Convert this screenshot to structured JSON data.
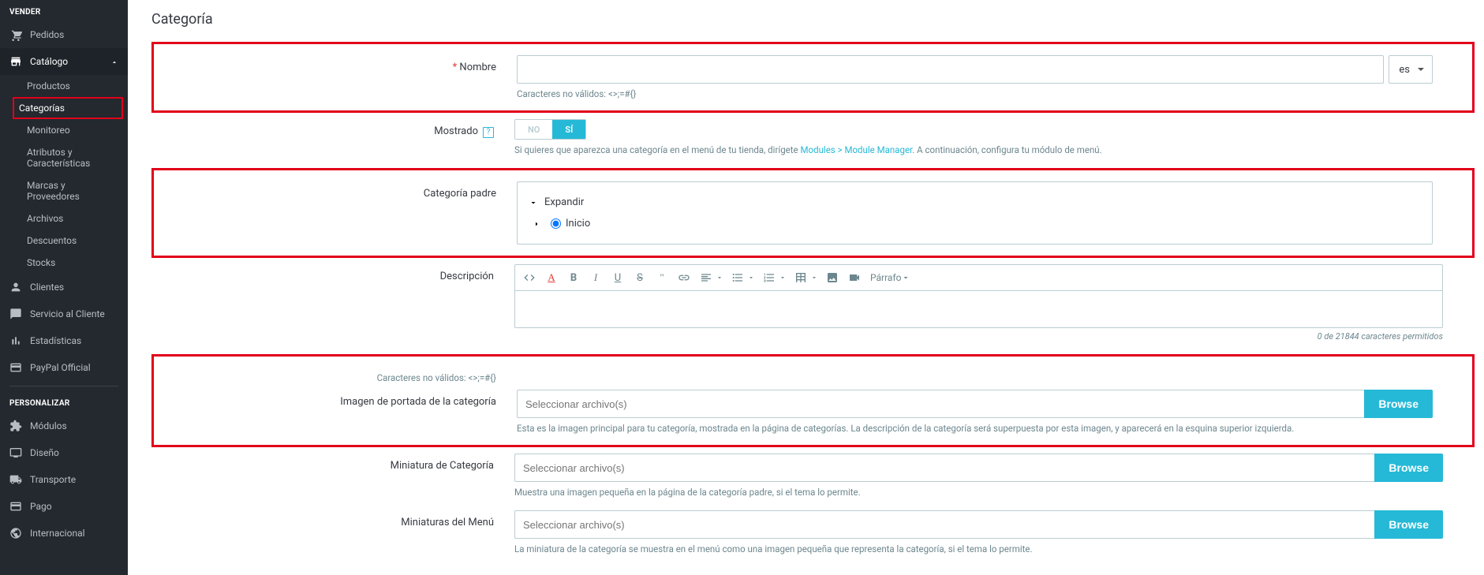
{
  "sidebar": {
    "sections": {
      "sell": {
        "title": "VENDER"
      },
      "customize": {
        "title": "PERSONALIZAR"
      }
    },
    "items": {
      "orders": "Pedidos",
      "catalog": "Catálogo",
      "customers": "Clientes",
      "service": "Servicio al Cliente",
      "stats": "Estadísticas",
      "paypal": "PayPal Official",
      "modules": "Módulos",
      "design": "Diseño",
      "shipping": "Transporte",
      "payment": "Pago",
      "intl": "Internacional"
    },
    "catalog_sub": {
      "products": "Productos",
      "categories": "Categorías",
      "monitoring": "Monitoreo",
      "attributes": "Atributos y Características",
      "brands": "Marcas y Proveedores",
      "files": "Archivos",
      "discounts": "Descuentos",
      "stocks": "Stocks"
    }
  },
  "page": {
    "title": "Categoría"
  },
  "form": {
    "name": {
      "label": "Nombre",
      "value": "",
      "lang": "es",
      "help": "Caracteres no válidos: <>;=#{}"
    },
    "displayed": {
      "label": "Mostrado",
      "no": "NO",
      "yes": "SÍ",
      "help_pre": "Si quieres que aparezca una categoría en el menú de tu tienda, dirígete ",
      "help_link": "Modules > Module Manager",
      "help_post": ". A continuación, configura tu módulo de menú."
    },
    "parent": {
      "label": "Categoría padre",
      "expand": "Expandir",
      "root": "Inicio"
    },
    "description": {
      "label": "Descripción",
      "paragraph": "Párrafo",
      "counter": "0 de 21844 caracteres permitidos",
      "invalid": "Caracteres no válidos: <>;=#{}"
    },
    "cover": {
      "label": "Imagen de portada de la categoría",
      "placeholder": "Seleccionar archivo(s)",
      "browse": "Browse",
      "help": "Esta es la imagen principal para tu categoría, mostrada en la página de categorías. La descripción de la categoría será superpuesta por esta imagen, y aparecerá en la esquina superior izquierda."
    },
    "thumb": {
      "label": "Miniatura de Categoría",
      "placeholder": "Seleccionar archivo(s)",
      "browse": "Browse",
      "help": "Muestra una imagen pequeña en la página de la categoría padre, si el tema lo permite."
    },
    "menu_thumb": {
      "label": "Miniaturas del Menú",
      "placeholder": "Seleccionar archivo(s)",
      "browse": "Browse",
      "help": "La miniatura de la categoría se muestra en el menú como una imagen pequeña que representa la categoría, si el tema lo permite."
    }
  }
}
